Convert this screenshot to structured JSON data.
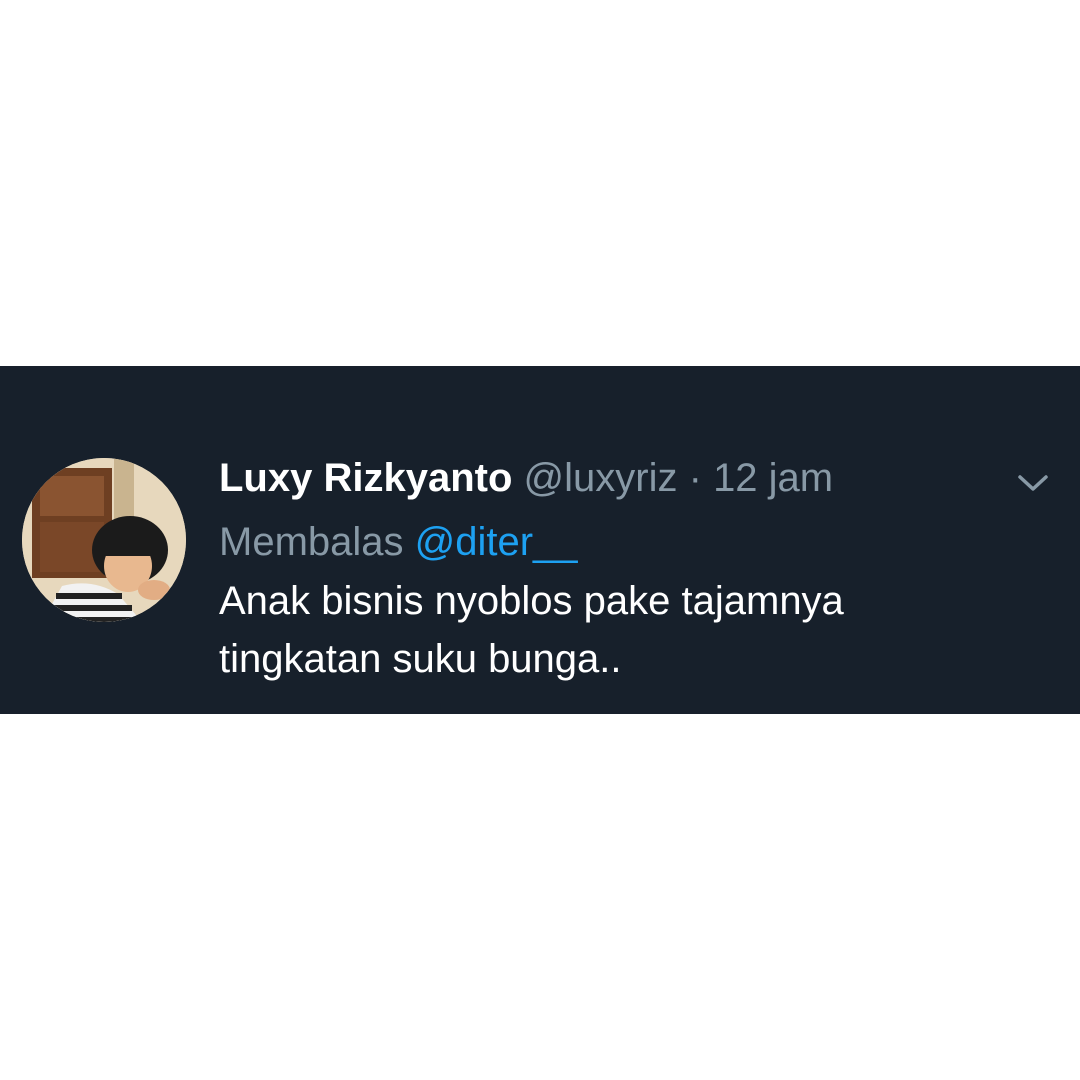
{
  "tweet": {
    "display_name": "Luxy Rizkyanto",
    "handle": "@luxyriz",
    "separator": "·",
    "time": "12 jam",
    "reply_prefix": "Membalas",
    "reply_mention": "@diter__",
    "text": "Anak bisnis nyoblos pake tajamnya tingkatan suku bunga..",
    "avatar_icon": "user-avatar-photo",
    "caret_icon": "chevron-down-icon"
  },
  "colors": {
    "card_background": "#17202b",
    "page_background": "#ffffff",
    "name_text": "#ffffff",
    "muted_text": "#8899a6",
    "mention": "#1da1f2"
  }
}
